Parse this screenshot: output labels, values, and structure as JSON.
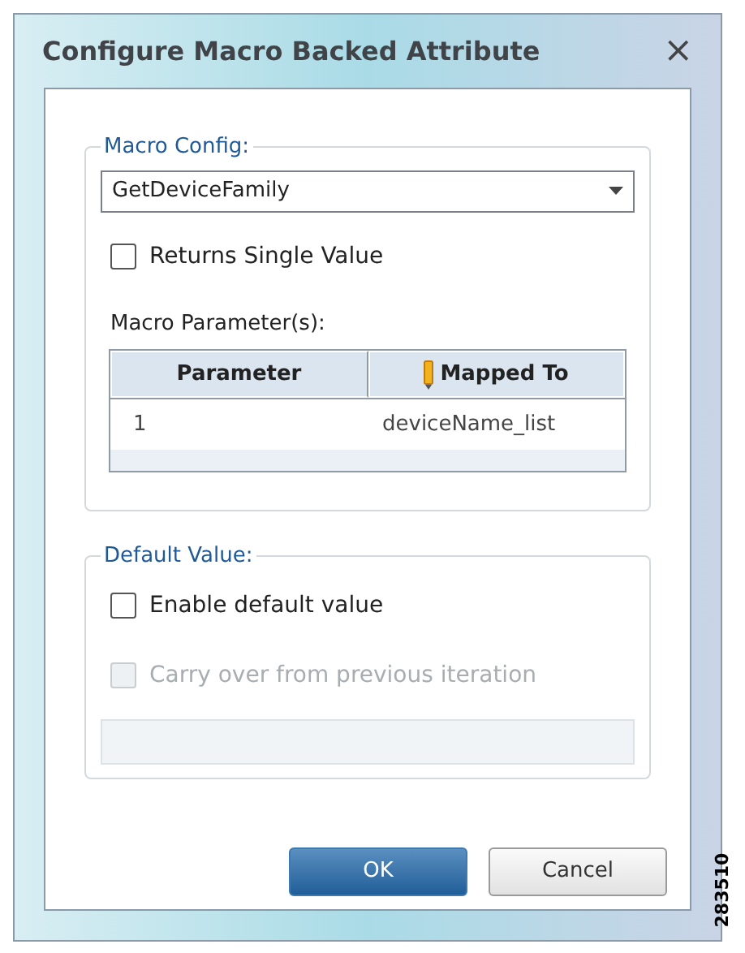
{
  "window": {
    "title": "Configure Macro Backed Attribute",
    "close": "×"
  },
  "macro_config": {
    "legend": "Macro Config:",
    "macro": {
      "value": "GetDeviceFamily"
    },
    "returns_single_value": {
      "label": "Returns Single Value",
      "checked": false,
      "disabled": false
    },
    "parameters_label": "Macro Parameter(s):",
    "table": {
      "columns": [
        "Parameter",
        "Mapped To"
      ],
      "rows": [
        [
          "1",
          "deviceName_list"
        ]
      ]
    }
  },
  "default_value": {
    "legend": "Default Value:",
    "checkboxes": [
      {
        "label": "Enable default value",
        "checked": false,
        "disabled": false
      },
      {
        "label": "Carry over from previous iteration",
        "checked": false,
        "disabled": true
      }
    ],
    "field": {
      "disabled": true
    }
  },
  "buttons": [
    {
      "label": "OK",
      "kind": "primary"
    },
    {
      "label": "Cancel",
      "kind": "secondary"
    }
  ],
  "figure_id": "283510"
}
